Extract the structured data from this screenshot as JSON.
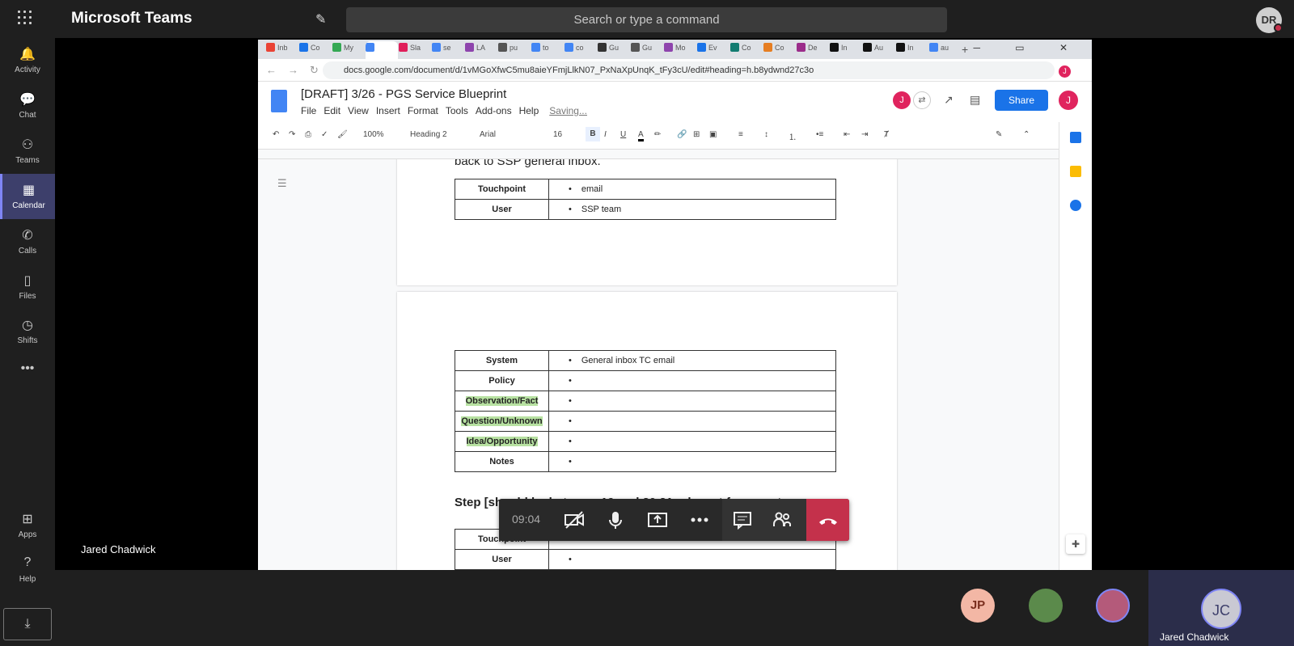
{
  "teams": {
    "app_title": "Microsoft Teams",
    "search_placeholder": "Search or type a command",
    "user_initials": "DR",
    "rail": [
      {
        "label": "Activity",
        "icon": "bell-icon"
      },
      {
        "label": "Chat",
        "icon": "chat-icon"
      },
      {
        "label": "Teams",
        "icon": "teams-icon"
      },
      {
        "label": "Calendar",
        "icon": "calendar-icon",
        "active": true
      },
      {
        "label": "Calls",
        "icon": "phone-icon"
      },
      {
        "label": "Files",
        "icon": "file-icon"
      },
      {
        "label": "Shifts",
        "icon": "clock-icon"
      },
      {
        "label": "...",
        "icon": "more-icon"
      },
      {
        "label": "Apps",
        "icon": "apps-icon"
      },
      {
        "label": "Help",
        "icon": "help-icon"
      }
    ],
    "presenter_name": "Jared Chadwick",
    "participants": [
      {
        "initials": "JP",
        "color": "#f3b7a5"
      },
      {
        "initials": "",
        "color": "#5b8a4b"
      },
      {
        "initials": "",
        "color": "#b45a7a"
      }
    ],
    "active_speaker": {
      "initials": "JC",
      "name": "Jared Chadwick"
    },
    "call": {
      "timer": "09:04"
    }
  },
  "browser": {
    "tabs": [
      "Inb",
      "Co",
      "My",
      "",
      "Sla",
      "se",
      "LA",
      "pu",
      "to",
      "co",
      "Gu",
      "Gu",
      "Mo",
      "Ev",
      "Co",
      "Co",
      "De",
      "In",
      "Au",
      "In",
      "au"
    ],
    "url": "docs.google.com/document/d/1vMGoXfwC5mu8aieYFmjLlkN07_PxNaXpUnqK_tFy3cU/edit#heading=h.b8ydwnd27c3o"
  },
  "doc": {
    "title": "[DRAFT] 3/26 - PGS Service Blueprint",
    "menus": [
      "File",
      "Edit",
      "View",
      "Insert",
      "Format",
      "Tools",
      "Add-ons",
      "Help"
    ],
    "saving": "Saving...",
    "share": "Share",
    "avatar_letter": "J",
    "toolbar": {
      "zoom": "100%",
      "style": "Heading 2",
      "font": "Arial",
      "size": "16"
    },
    "text_top": "back to SSP general inbox.",
    "table1": [
      {
        "key": "Touchpoint",
        "value": "email"
      },
      {
        "key": "User",
        "value": "SSP team"
      }
    ],
    "table2": [
      {
        "key": "System",
        "value": "General inbox TC email",
        "hl": false
      },
      {
        "key": "Policy",
        "value": "",
        "hl": false
      },
      {
        "key": "Observation/Fact",
        "value": "",
        "hl": true
      },
      {
        "key": "Question/Unknown",
        "value": "",
        "hl": true
      },
      {
        "key": "Idea/Opportunity",
        "value": "",
        "hl": true
      },
      {
        "key": "Notes",
        "value": "",
        "hl": false
      }
    ],
    "step_heading": "Step [should be between 19 and 20 21 relevant for secret",
    "table3": [
      {
        "key": "Touchpoint",
        "value": ""
      },
      {
        "key": "User",
        "value": ""
      }
    ]
  }
}
